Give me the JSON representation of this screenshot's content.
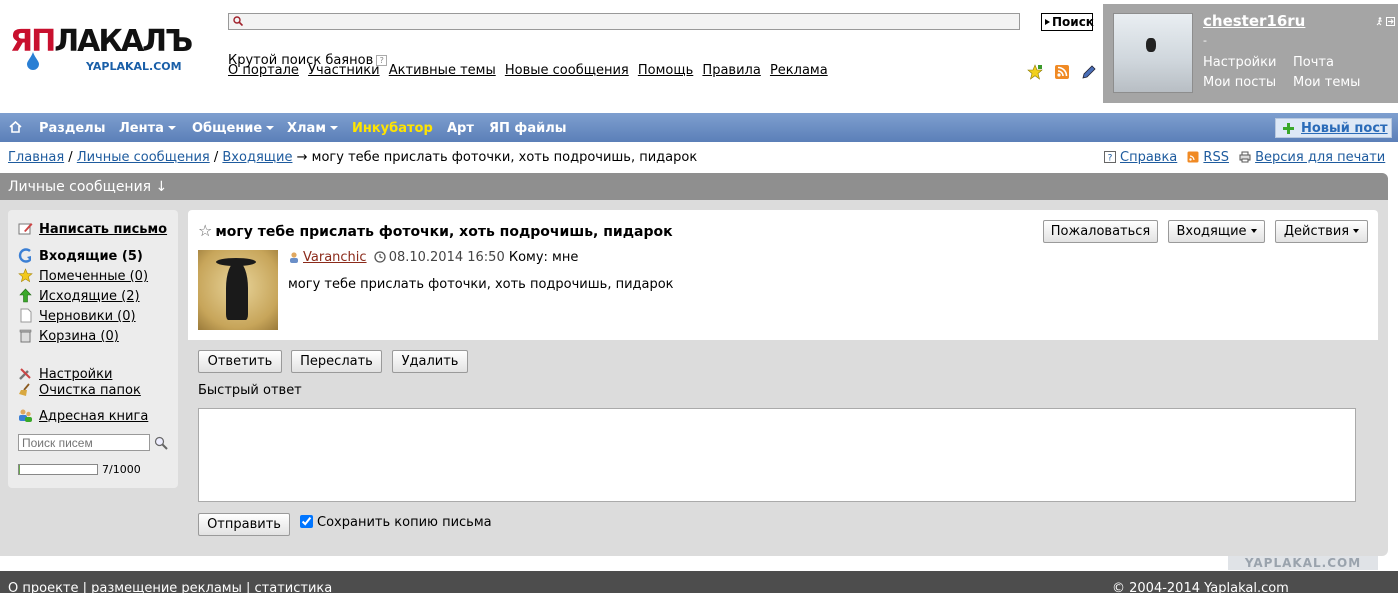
{
  "logo": {
    "wordmark_ya": "ЯП",
    "wordmark_rest": "ЛАКАЛЪ",
    "sub": "YAPLAKAL.COM"
  },
  "search": {
    "button": "Поиск",
    "placeholder": ""
  },
  "bayan": {
    "text": "Крутой поиск баянов",
    "help": "?"
  },
  "topnav": [
    "О портале",
    "Участники",
    "Активные темы",
    "Новые сообщения",
    "Помощь",
    "Правила",
    "Реклама"
  ],
  "user": {
    "name": "chester16ru",
    "dash": "-",
    "settings": "Настройки",
    "mail": "Почта",
    "my_posts": "Мои посты",
    "my_topics": "Мои темы"
  },
  "menu": {
    "sections": "Разделы",
    "feed": "Лента",
    "social": "Общение",
    "junk": "Хлам",
    "incubator": "Инкубатор",
    "art": "Арт",
    "files": "ЯП файлы",
    "new_post": "Новый пост"
  },
  "breadcrumb": {
    "home": "Главная",
    "pm": "Личные сообщения",
    "inbox": "Входящие",
    "sep": "/",
    "arrow": "→",
    "current": "могу тебе прислать фоточки, хоть подрочишь, пидарок"
  },
  "tools": {
    "help": "Справка",
    "rss": "RSS",
    "print": "Версия для печати"
  },
  "section": {
    "title": "Личные сообщения ↓"
  },
  "sidebar": {
    "compose": "Написать письмо",
    "folders": [
      {
        "label": "Входящие (5)",
        "bold": true
      },
      {
        "label": "Помеченные (0)"
      },
      {
        "label": "Исходящие (2)"
      },
      {
        "label": "Черновики (0)"
      },
      {
        "label": "Корзина (0)"
      }
    ],
    "settings": "Настройки",
    "clean": "Очистка папок",
    "addressbook": "Адресная книга",
    "search_placeholder": "Поиск писем",
    "quota_text": "7/1000",
    "quota_fraction": 0.007
  },
  "message": {
    "subject": "могу тебе прислать фоточки, хоть подрочишь, пидарок",
    "author": "Varanchic",
    "date": "08.10.2014 16:50",
    "to": "Кому: мне",
    "body": "могу тебе прислать фоточки, хоть подрочишь, пидарок",
    "complain": "Пожаловаться",
    "inbox_menu": "Входящие",
    "actions_menu": "Действия",
    "reply": "Ответить",
    "forward": "Переслать",
    "delete": "Удалить",
    "quick_reply": "Быстрый ответ",
    "send": "Отправить",
    "save_copy": "Сохранить копию письма"
  },
  "watermark": "YAPLAKAL.COM",
  "footer": {
    "about": "О проекте",
    "ads": "размещение рекламы",
    "stats": "статистика",
    "sep": " | ",
    "copyright": "© 2004-2014 Yaplakal.com"
  },
  "colors": {
    "menu": "#5b7fb8",
    "incubator": "#ffe400",
    "link": "#1e5b9e",
    "author": "#8b2a1a",
    "footer": "#4d4d4d"
  }
}
